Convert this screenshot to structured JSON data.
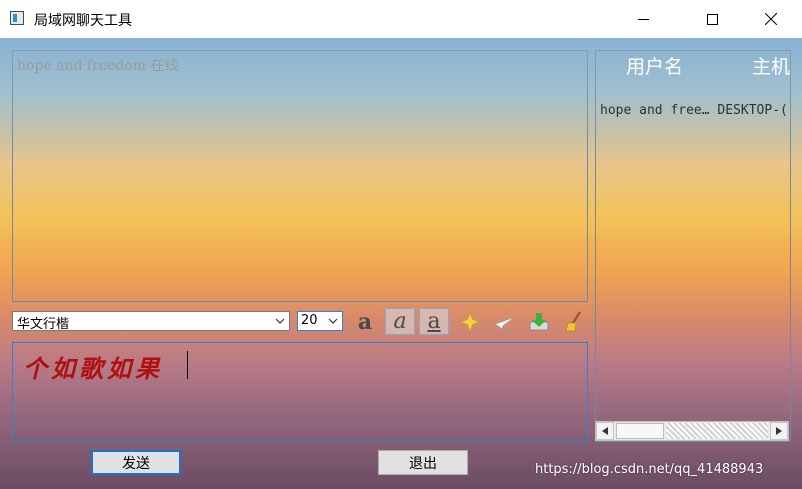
{
  "window": {
    "title": "局域网聊天工具"
  },
  "chat": {
    "history_line": "hope and freedom 在线"
  },
  "users": {
    "columns": [
      "用户名",
      "主机"
    ],
    "rows": [
      {
        "name": "hope and free…",
        "host": "DESKTOP-("
      }
    ]
  },
  "toolbar": {
    "font_value": "华文行楷",
    "size_value": "20",
    "bold_icon": "bold-icon",
    "italic_icon": "italic-icon",
    "underline_icon": "underline-icon",
    "color_icon": "color-icon",
    "send_file_icon": "paper-plane-icon",
    "save_icon": "save-download-icon",
    "clear_icon": "broom-icon"
  },
  "input": {
    "text": "个如歌如果"
  },
  "buttons": {
    "send": "发送",
    "exit": "退出"
  },
  "watermark": "https://blog.csdn.net/qq_41488943",
  "colors": {
    "accent": "#2f83d0",
    "input_text": "#b01010",
    "header_text": "#ffffff"
  }
}
